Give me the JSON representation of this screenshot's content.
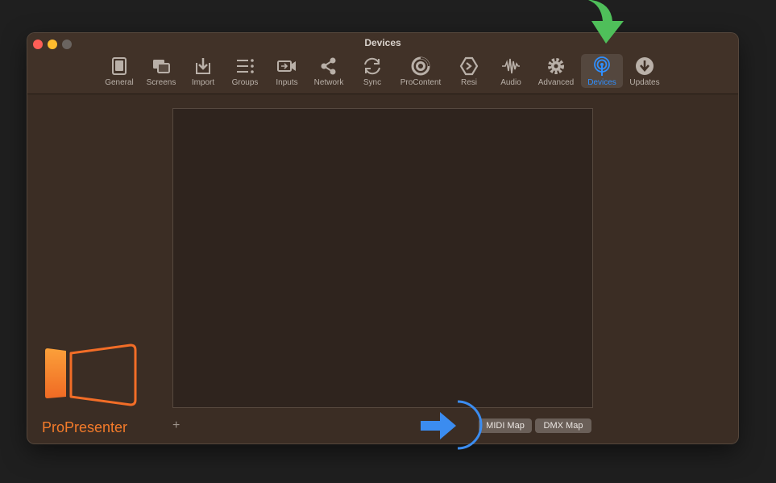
{
  "window": {
    "title": "Devices"
  },
  "toolbar": {
    "items": [
      {
        "label": "General",
        "icon": "general-icon"
      },
      {
        "label": "Screens",
        "icon": "screens-icon"
      },
      {
        "label": "Import",
        "icon": "import-icon"
      },
      {
        "label": "Groups",
        "icon": "groups-icon"
      },
      {
        "label": "Inputs",
        "icon": "inputs-icon"
      },
      {
        "label": "Network",
        "icon": "network-icon"
      },
      {
        "label": "Sync",
        "icon": "sync-icon"
      },
      {
        "label": "ProContent",
        "icon": "procontent-icon"
      },
      {
        "label": "Resi",
        "icon": "resi-icon"
      },
      {
        "label": "Audio",
        "icon": "audio-icon"
      },
      {
        "label": "Advanced",
        "icon": "gear-icon"
      },
      {
        "label": "Devices",
        "icon": "devices-icon",
        "selected": true
      },
      {
        "label": "Updates",
        "icon": "updates-icon"
      }
    ]
  },
  "devices": {
    "add_label": "+",
    "midi_map_label": "MIDI Map",
    "dmx_map_label": "DMX Map"
  },
  "brand": {
    "name": "ProPresenter"
  },
  "colors": {
    "background": "#1f1f1f",
    "window": "#3b2d24",
    "accent_selected": "#2f8fff",
    "brand_orange": "#f47b2a",
    "annotation_green": "#4fbf5a",
    "annotation_blue": "#3b8cf0"
  }
}
